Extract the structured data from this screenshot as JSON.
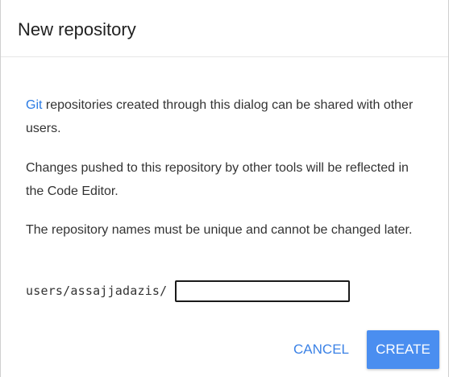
{
  "dialog": {
    "title": "New repository",
    "paragraph1": {
      "link_text": "Git",
      "text": " repositories created through this dialog can be shared with other users."
    },
    "paragraph2": "Changes pushed to this repository by other tools will be reflected in the Code Editor.",
    "paragraph3": "The repository names must be unique and cannot be changed later.",
    "repo_prefix": "users/assajjadazis/",
    "repo_name_value": "",
    "cancel_label": "CANCEL",
    "create_label": "CREATE"
  },
  "colors": {
    "link": "#2a7be4",
    "primary_button": "#4a8ef0",
    "cancel_text": "#3b82e6"
  }
}
